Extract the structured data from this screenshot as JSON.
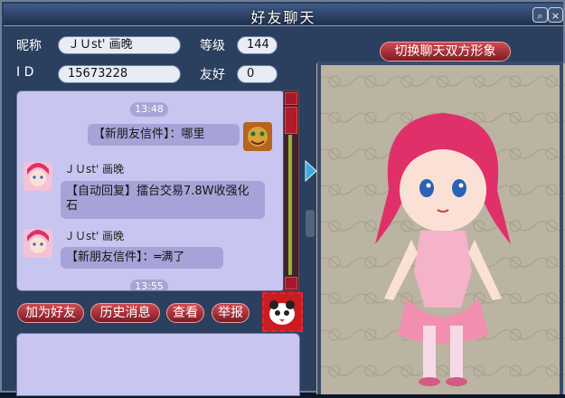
{
  "window": {
    "title": "好友聊天"
  },
  "profile": {
    "nickname_label": "昵称",
    "nickname": "ＪＵst' 画晚",
    "id_label": "I D",
    "id": "15673228",
    "level_label": "等级",
    "level": "144",
    "friendship_label": "友好",
    "friendship": "0"
  },
  "chat": {
    "messages": [
      {
        "time": "13:48"
      },
      {
        "text": "【新朋友信件】：哪里",
        "side": "right"
      },
      {
        "sender": "ＪＵst' 画晚",
        "text": "【自动回复】擂台交易7.8W收强化石",
        "side": "left"
      },
      {
        "sender": "ＪＵst' 画晚",
        "text": "【新朋友信件】：═满了",
        "side": "left"
      },
      {
        "time": "13:55"
      }
    ]
  },
  "buttons": {
    "add_friend": "加为好友",
    "history": "历史消息",
    "view": "查看",
    "report": "举报",
    "switch_avatar": "切换聊天双方形象"
  },
  "icons": {
    "help": "help-icon",
    "close": "close-icon",
    "emote": "emote-icon"
  },
  "colors": {
    "accent": "#c0212e",
    "chat_bg": "#c8c5f0",
    "frame": "#2b3f5e"
  }
}
